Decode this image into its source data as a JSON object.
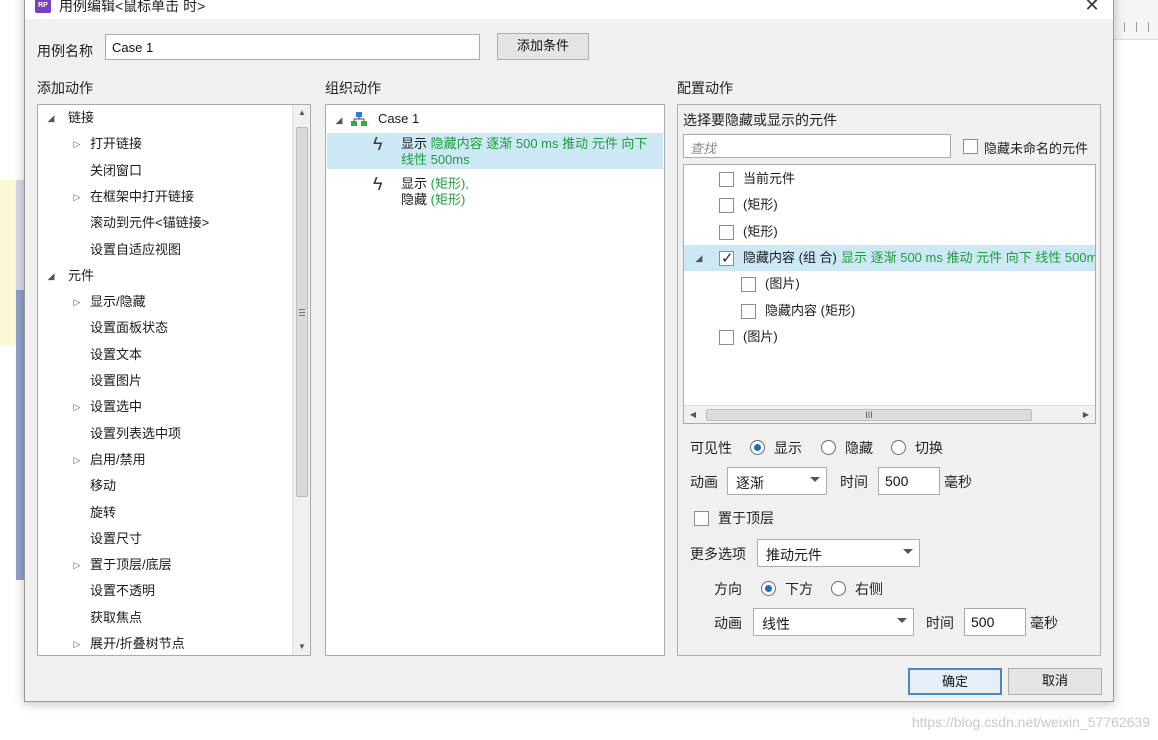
{
  "dialog": {
    "title": "用例编辑<鼠标单击 时>",
    "app_icon_label": "RP"
  },
  "case_name": {
    "label": "用例名称",
    "value": "Case 1",
    "add_condition_button": "添加条件"
  },
  "add_actions": {
    "header": "添加动作",
    "items": [
      {
        "label": "链接",
        "level": 0,
        "expander": "expanded"
      },
      {
        "label": "打开链接",
        "level": 1,
        "expander": "collapsed"
      },
      {
        "label": "关闭窗口",
        "level": 1,
        "expander": "none"
      },
      {
        "label": "在框架中打开链接",
        "level": 1,
        "expander": "collapsed"
      },
      {
        "label": "滚动到元件<锚链接>",
        "level": 1,
        "expander": "none"
      },
      {
        "label": "设置自适应视图",
        "level": 1,
        "expander": "none"
      },
      {
        "label": "元件",
        "level": 0,
        "expander": "expanded"
      },
      {
        "label": "显示/隐藏",
        "level": 1,
        "expander": "collapsed"
      },
      {
        "label": "设置面板状态",
        "level": 1,
        "expander": "none"
      },
      {
        "label": "设置文本",
        "level": 1,
        "expander": "none"
      },
      {
        "label": "设置图片",
        "level": 1,
        "expander": "none"
      },
      {
        "label": "设置选中",
        "level": 1,
        "expander": "collapsed"
      },
      {
        "label": "设置列表选中项",
        "level": 1,
        "expander": "none"
      },
      {
        "label": "启用/禁用",
        "level": 1,
        "expander": "collapsed"
      },
      {
        "label": "移动",
        "level": 1,
        "expander": "none"
      },
      {
        "label": "旋转",
        "level": 1,
        "expander": "none"
      },
      {
        "label": "设置尺寸",
        "level": 1,
        "expander": "none"
      },
      {
        "label": "置于顶层/底层",
        "level": 1,
        "expander": "collapsed"
      },
      {
        "label": "设置不透明",
        "level": 1,
        "expander": "none"
      },
      {
        "label": "获取焦点",
        "level": 1,
        "expander": "none"
      },
      {
        "label": "展开/折叠树节点",
        "level": 1,
        "expander": "collapsed"
      }
    ]
  },
  "organize_actions": {
    "header": "组织动作",
    "case_label": "Case 1",
    "action1": {
      "verb": "显示",
      "detail_line1": "隐藏内容 逐渐 500 ms 推动 元件 向下",
      "detail_line2": "线性 500ms"
    },
    "action2": {
      "verb1": "显示",
      "target1": "(矩形),",
      "verb2": "隐藏",
      "target2": "(矩形)"
    }
  },
  "configure_actions": {
    "header": "配置动作",
    "select_label": "选择要隐藏或显示的元件",
    "search_placeholder": "查找",
    "hide_unnamed_label": "隐藏未命名的元件",
    "widgets": [
      {
        "label": "当前元件",
        "checked": false
      },
      {
        "label": "(矩形)",
        "checked": false
      },
      {
        "label": "(矩形)",
        "checked": false
      },
      {
        "label": "隐藏内容 (组 合)",
        "checked": true,
        "detail": "显示 逐渐 500 ms 推动 元件 向下 线性 500m"
      },
      {
        "label": "(图片)",
        "checked": false
      },
      {
        "label": "隐藏内容 (矩形)",
        "checked": false
      },
      {
        "label": "(图片)",
        "checked": false
      }
    ],
    "hscroll_grip": "III",
    "visibility": {
      "label": "可见性",
      "options": [
        "显示",
        "隐藏",
        "切换"
      ],
      "selected": "显示"
    },
    "animation": {
      "label": "动画",
      "value": "逐渐",
      "time_label": "时间",
      "time_value": "500",
      "unit": "毫秒"
    },
    "bring_to_front": {
      "label": "置于顶层",
      "checked": false
    },
    "more_options": {
      "label": "更多选项",
      "value": "推动元件"
    },
    "direction": {
      "label": "方向",
      "options": [
        "下方",
        "右侧"
      ],
      "selected": "下方"
    },
    "push_animation": {
      "label": "动画",
      "value": "线性",
      "time_label": "时间",
      "time_value": "500",
      "unit": "毫秒"
    }
  },
  "footer": {
    "ok_button": "确定",
    "cancel_button": "取消"
  },
  "watermark": "https://blog.csdn.net/weixin_57762639",
  "colors": {
    "selection": "#cce8f4",
    "detail_text": "#1f9d3a",
    "dialog_bg": "#f0f0f0"
  }
}
